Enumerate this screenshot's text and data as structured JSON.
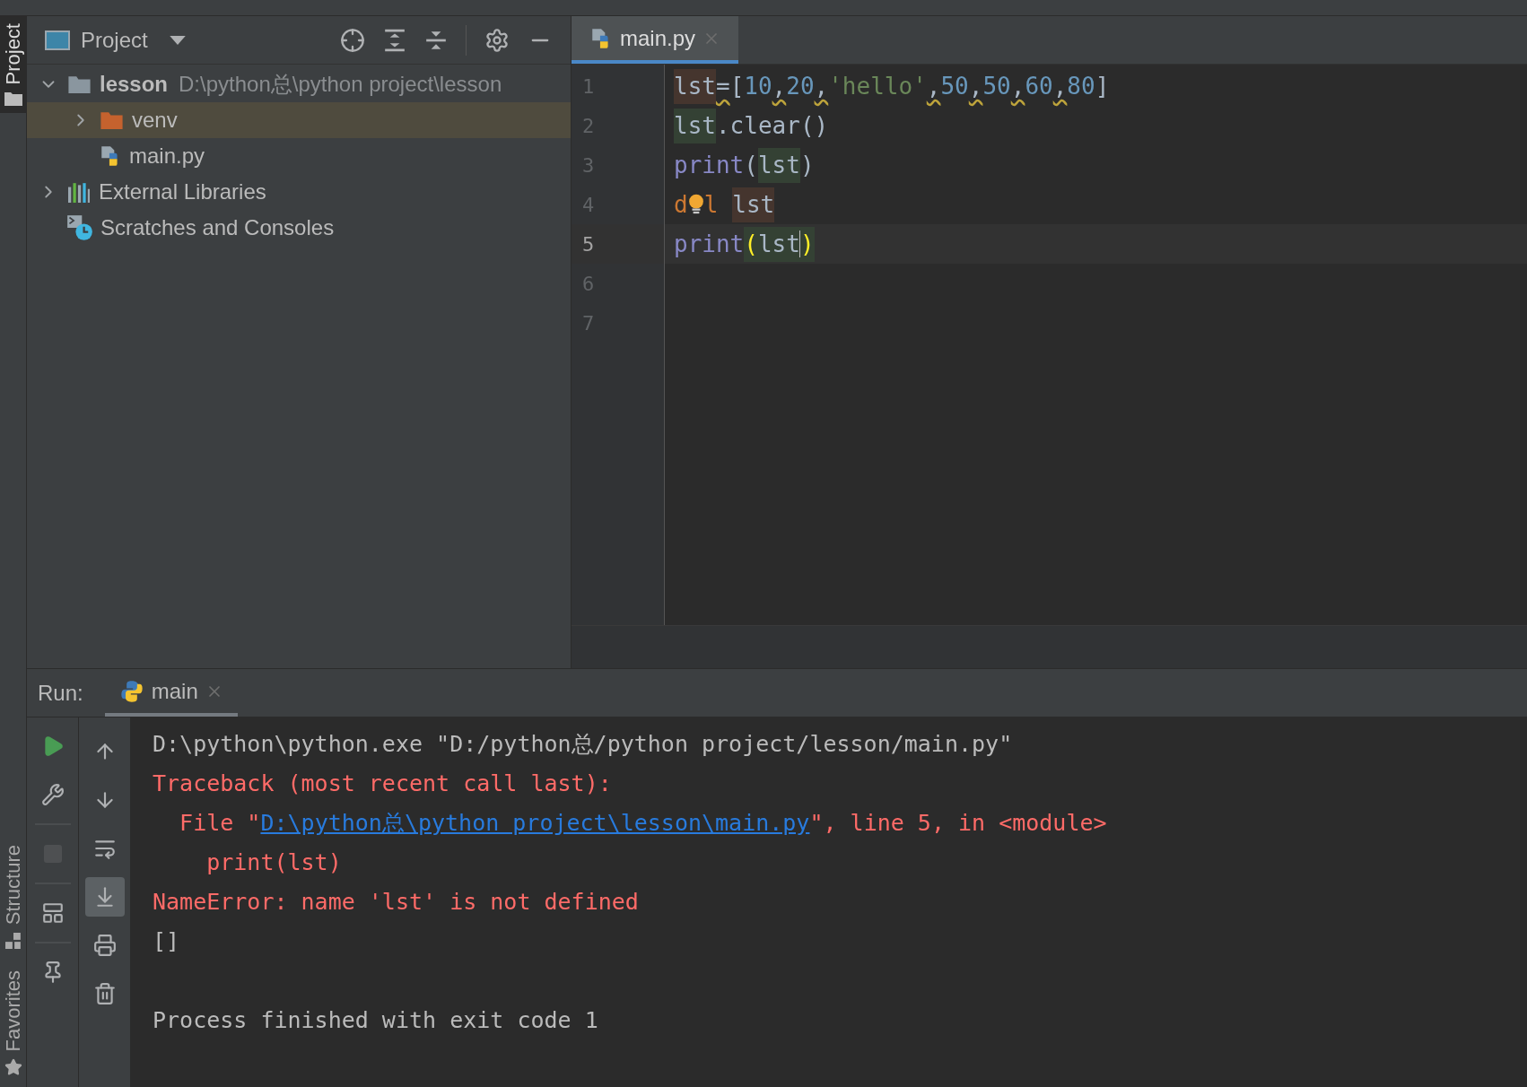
{
  "side_tabs": [
    {
      "label": "Project",
      "selected": true
    },
    {
      "label": "Structure",
      "selected": false
    },
    {
      "label": "Favorites",
      "selected": false
    }
  ],
  "project_panel": {
    "title": "Project",
    "tree": [
      {
        "label": "lesson",
        "path": "D:\\python总\\python project\\lesson",
        "kind": "module",
        "expanded": true,
        "selected": false,
        "children": [
          {
            "label": "venv",
            "kind": "folder",
            "expanded": false,
            "selected": true
          },
          {
            "label": "main.py",
            "kind": "pyfile",
            "selected": false
          }
        ]
      },
      {
        "label": "External Libraries",
        "kind": "libraries",
        "expanded": false,
        "selected": false
      },
      {
        "label": "Scratches and Consoles",
        "kind": "scratches",
        "selected": false
      }
    ]
  },
  "editor": {
    "tabs": [
      {
        "label": "main.py",
        "selected": true
      }
    ],
    "lines": [
      {
        "number": "1",
        "current": false,
        "tokens": [
          {
            "text": "lst",
            "kind": "ident",
            "write_highlight": true
          },
          {
            "text": "=",
            "kind": "op",
            "warning": true
          },
          {
            "text": "[",
            "kind": "op"
          },
          {
            "text": "10",
            "kind": "number"
          },
          {
            "text": ",",
            "kind": "op",
            "warning": true
          },
          {
            "text": "20",
            "kind": "number"
          },
          {
            "text": ",",
            "kind": "op",
            "warning": true
          },
          {
            "text": "'hello'",
            "kind": "string"
          },
          {
            "text": ",",
            "kind": "op",
            "warning": true
          },
          {
            "text": "50",
            "kind": "number"
          },
          {
            "text": ",",
            "kind": "op",
            "warning": true
          },
          {
            "text": "50",
            "kind": "number"
          },
          {
            "text": ",",
            "kind": "op",
            "warning": true
          },
          {
            "text": "60",
            "kind": "number"
          },
          {
            "text": ",",
            "kind": "op",
            "warning": true
          },
          {
            "text": "80",
            "kind": "number"
          },
          {
            "text": "]",
            "kind": "op"
          }
        ]
      },
      {
        "number": "2",
        "current": false,
        "tokens": [
          {
            "text": "lst",
            "kind": "ident",
            "read_highlight": true
          },
          {
            "text": ".clear()",
            "kind": "op"
          }
        ]
      },
      {
        "number": "3",
        "current": false,
        "tokens": [
          {
            "text": "print",
            "kind": "builtin"
          },
          {
            "text": "(",
            "kind": "op"
          },
          {
            "text": "lst",
            "kind": "ident",
            "read_highlight": true
          },
          {
            "text": ")",
            "kind": "op"
          }
        ]
      },
      {
        "number": "4",
        "current": false,
        "tokens": [
          {
            "text": "d",
            "kind": "keyword"
          },
          {
            "kind": "bulb"
          },
          {
            "text": "l",
            "kind": "keyword"
          },
          {
            "text": "lst",
            "kind": "ident",
            "write_highlight": true
          }
        ]
      },
      {
        "number": "5",
        "current": true,
        "tokens": [
          {
            "text": "print",
            "kind": "builtin"
          },
          {
            "text": "(",
            "kind": "brace",
            "read_highlight": true
          },
          {
            "text": "lst",
            "kind": "ident",
            "read_highlight": true
          },
          {
            "kind": "caret"
          },
          {
            "text": ")",
            "kind": "brace",
            "read_highlight": true
          }
        ]
      },
      {
        "number": "6",
        "current": false
      },
      {
        "number": "7",
        "current": false
      }
    ]
  },
  "run_panel": {
    "label": "Run:",
    "tabs": [
      {
        "label": "main",
        "selected": true
      }
    ],
    "toolbar_left": [
      {
        "kind": "play"
      },
      {
        "kind": "wrench"
      },
      {
        "kind": "stop",
        "disabled": true
      },
      {
        "kind": "layout"
      },
      {
        "kind": "pin"
      }
    ],
    "toolbar_right": [
      {
        "kind": "up",
        "selected": false
      },
      {
        "kind": "down",
        "selected": false
      },
      {
        "kind": "wrap",
        "selected": false
      },
      {
        "kind": "scroll_end",
        "selected": true
      },
      {
        "kind": "print",
        "selected": false
      },
      {
        "kind": "trash",
        "selected": false
      }
    ],
    "console": [
      {
        "kind": "command",
        "segments": [
          {
            "text": "D:\\python\\python.exe \"D:/python总/python project/lesson/main.py\""
          }
        ]
      },
      {
        "kind": "error",
        "segments": [
          {
            "text": "Traceback (most recent call last):"
          }
        ]
      },
      {
        "kind": "error",
        "segments": [
          {
            "text": "  File \""
          },
          {
            "text": "D:\\python总\\python project\\lesson\\main.py",
            "link": true
          },
          {
            "text": "\", line 5, in <module>"
          }
        ]
      },
      {
        "kind": "error",
        "segments": [
          {
            "text": "    print(lst)"
          }
        ]
      },
      {
        "kind": "error",
        "segments": [
          {
            "text": "NameError: name 'lst' is not defined"
          }
        ]
      },
      {
        "kind": "output",
        "segments": [
          {
            "text": "[]"
          }
        ]
      },
      {
        "kind": "exit",
        "segments": [
          {
            "text": "Process finished with exit code 1"
          }
        ]
      }
    ]
  }
}
